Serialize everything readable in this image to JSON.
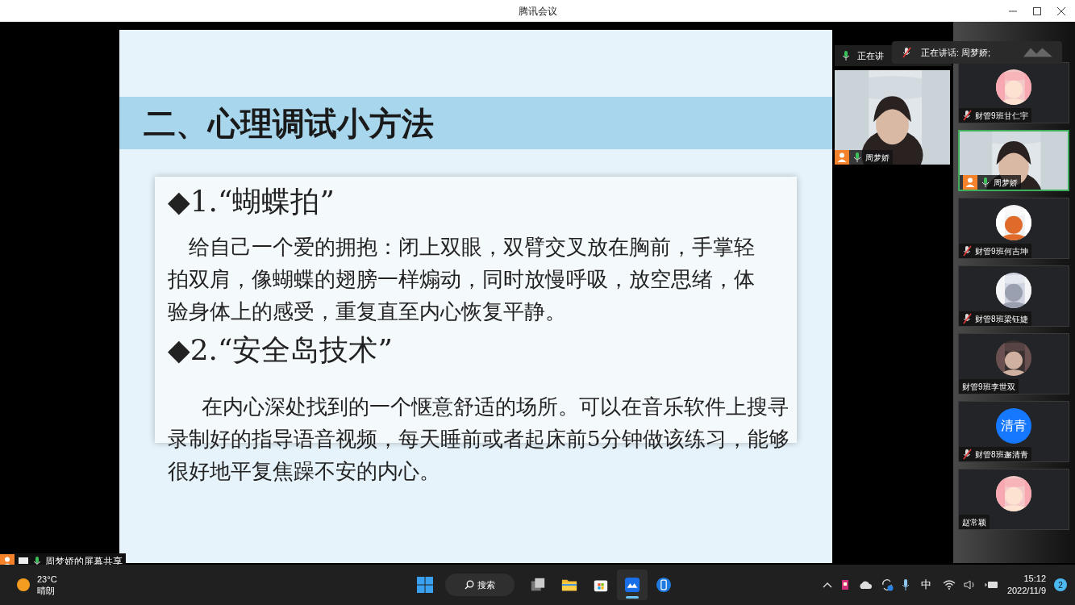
{
  "window": {
    "title": "腾讯会议"
  },
  "slide": {
    "title": "二、心理调试小方法",
    "sections": [
      {
        "heading": "◆1.“蝴蝶拍”",
        "body": "给自己一个爱的拥抱：闭上双眼，双臂交叉放在胸前，手掌轻拍双肩，像蝴蝶的翅膀一样煽动，同时放慢呼吸，放空思绪，体验身体上的感受，重复直至内心恢复平静。"
      },
      {
        "heading": "◆2.“安全岛技术”",
        "body": "在内心深处找到的一个惬意舒适的场所。可以在音乐软件上搜寻录制好的指导语音视频，每天睡前或者起床前5分钟做该练习，能够很好地平复焦躁不安的内心。"
      }
    ]
  },
  "speaker_bars": [
    {
      "text": "正在讲"
    },
    {
      "text": "正在讲话: 周梦娇;"
    }
  ],
  "main_video": {
    "name": "周梦娇"
  },
  "participants": [
    {
      "name": "财管9班甘仁宇",
      "kind": "avatar",
      "muted": true,
      "selected": false
    },
    {
      "name": "周梦娇",
      "kind": "video",
      "muted": false,
      "selected": true
    },
    {
      "name": "财管9班何吉坤",
      "kind": "avatar",
      "muted": true,
      "selected": false
    },
    {
      "name": "财管8班梁钰婕",
      "kind": "avatar",
      "muted": true,
      "selected": false
    },
    {
      "name": "财管9班李世双",
      "kind": "avatar",
      "selected": false
    },
    {
      "name": "财管8班邂清青",
      "kind": "initials",
      "initials": "清青",
      "muted": true,
      "selected": false
    },
    {
      "name": "赵常颖",
      "kind": "avatar",
      "selected": false
    }
  ],
  "share_label": "周梦娇的屏幕共享",
  "taskbar": {
    "weather": {
      "temp": "23°C",
      "desc": "晴朗"
    },
    "search": "搜索",
    "apps": [
      {
        "kind": "taskview",
        "active": false
      },
      {
        "kind": "folder",
        "active": false
      },
      {
        "kind": "store",
        "active": false
      },
      {
        "kind": "meeting",
        "active": true
      },
      {
        "kind": "phone",
        "active": false
      }
    ],
    "ime": "中",
    "time": "15:12",
    "date": "2022/11/9",
    "notifications": "2"
  }
}
